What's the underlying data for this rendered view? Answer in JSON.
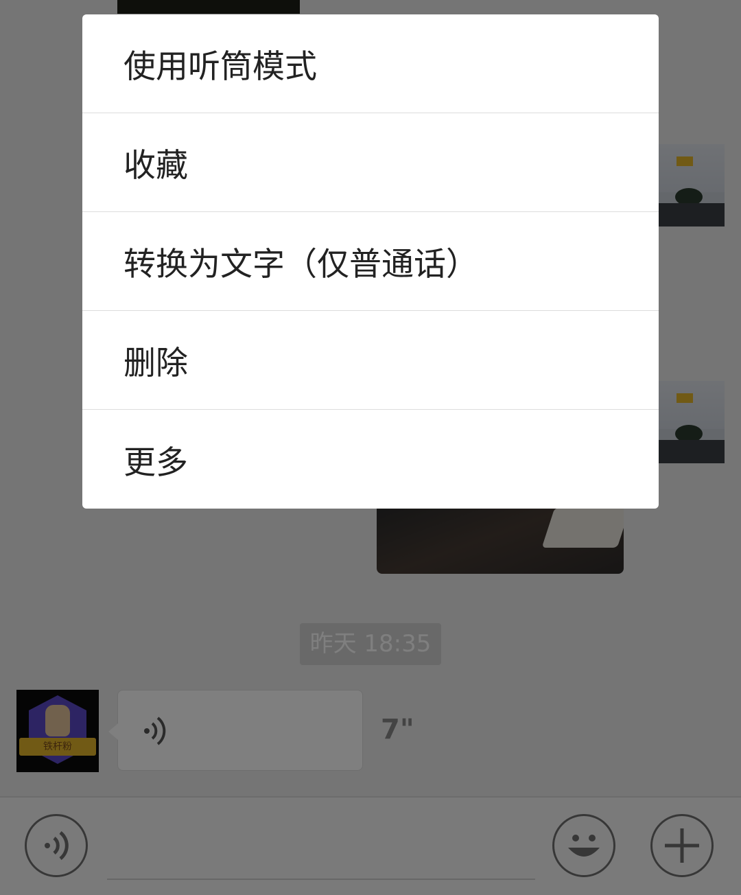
{
  "chat": {
    "timestamp": "昨天 18:35",
    "voice_message": {
      "duration": "7\""
    },
    "avatar": {
      "badge_text": "铁杆粉"
    }
  },
  "context_menu": {
    "items": [
      {
        "label": "使用听筒模式"
      },
      {
        "label": "收藏"
      },
      {
        "label": "转换为文字（仅普通话）"
      },
      {
        "label": "删除"
      },
      {
        "label": "更多"
      }
    ]
  },
  "input_bar": {
    "voice_icon": "voice-toggle-icon",
    "emoji_icon": "emoji-icon",
    "plus_icon": "plus-icon"
  },
  "colors": {
    "overlay": "rgba(0,0,0,0.5)",
    "menu_bg": "#ffffff",
    "chat_bg": "#ebebeb"
  }
}
